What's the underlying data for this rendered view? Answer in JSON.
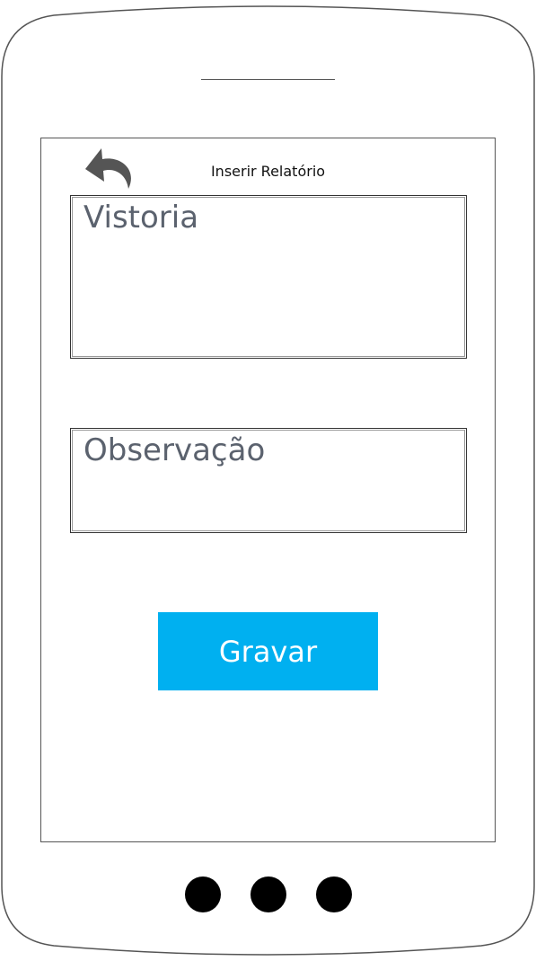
{
  "header": {
    "title": "Inserir Relatório",
    "back_icon": "undo-arrow-icon"
  },
  "form": {
    "vistoria": {
      "placeholder": "Vistoria",
      "value": ""
    },
    "observacao": {
      "placeholder": "Observação",
      "value": ""
    },
    "save_label": "Gravar"
  },
  "colors": {
    "accent": "#00b0f0",
    "placeholder_text": "#5b626e",
    "frame": "#555555"
  }
}
